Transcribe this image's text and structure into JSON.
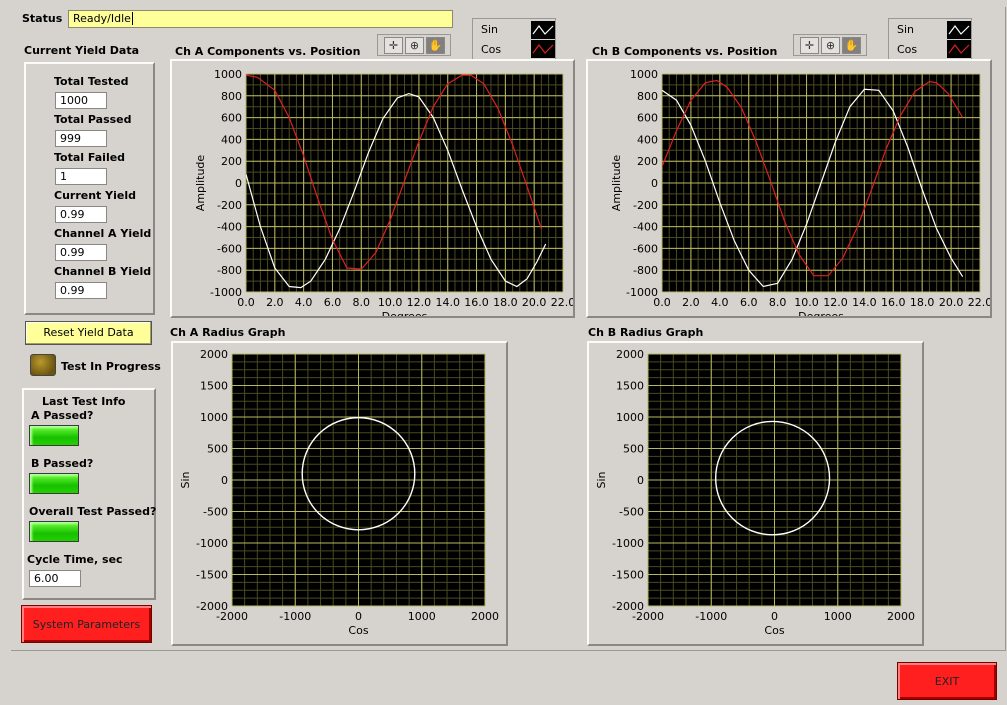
{
  "status": {
    "label": "Status",
    "value": "Ready/Idle"
  },
  "yield": {
    "title": "Current Yield Data",
    "total_tested_label": "Total Tested",
    "total_tested": "1000",
    "total_passed_label": "Total Passed",
    "total_passed": "999",
    "total_failed_label": "Total Failed",
    "total_failed": "1",
    "current_yield_label": "Current Yield",
    "current_yield": "0.99",
    "channel_a_yield_label": "Channel A Yield",
    "channel_a_yield": "0.99",
    "channel_b_yield_label": "Channel B Yield",
    "channel_b_yield": "0.99"
  },
  "reset_button": "Reset Yield Data",
  "test_in_progress_label": "Test In Progress",
  "last_test": {
    "title": "Last Test Info",
    "a_passed_label": "A Passed?",
    "b_passed_label": "B Passed?",
    "overall_label": "Overall Test Passed?",
    "cycle_time_label": "Cycle Time, sec",
    "cycle_time": "6.00"
  },
  "system_parameters_button": "System Parameters",
  "exit_button": "EXIT",
  "legend": {
    "sin": "Sin",
    "cos": "Cos"
  },
  "colors": {
    "sin": "#ffffff",
    "cos": "#e02020",
    "plot_bg": "#000000",
    "grid": "#b8b860",
    "led_green": "#22d000",
    "button_red": "#ff1f1f",
    "status_bg": "#ffff99"
  },
  "chart_data": [
    {
      "id": "chA",
      "type": "line",
      "title": "Ch A Components vs. Position",
      "xlabel": "Degrees",
      "ylabel": "Amplitude",
      "xlim": [
        0,
        22
      ],
      "ylim": [
        -1000,
        1000
      ],
      "xticks": [
        "0.0",
        "2.0",
        "4.0",
        "6.0",
        "8.0",
        "10.0",
        "12.0",
        "14.0",
        "16.0",
        "18.0",
        "20.0",
        "22.0"
      ],
      "yticks": [
        "1000",
        "800",
        "600",
        "400",
        "200",
        "0",
        "-200",
        "-400",
        "-600",
        "-800",
        "-1000"
      ],
      "series": [
        {
          "name": "Sin",
          "color": "#ffffff",
          "x": [
            0,
            1,
            2,
            3,
            3.8,
            4.5,
            5.5,
            6.5,
            7.5,
            8.5,
            9.5,
            10.5,
            11.3,
            12,
            13,
            14,
            15,
            16,
            17,
            18,
            18.8,
            19.5,
            20.2,
            20.8
          ],
          "y": [
            80,
            -400,
            -780,
            -950,
            -960,
            -900,
            -700,
            -420,
            -80,
            280,
            590,
            780,
            820,
            790,
            600,
            300,
            -60,
            -400,
            -700,
            -900,
            -950,
            -880,
            -720,
            -560
          ]
        },
        {
          "name": "Cos",
          "color": "#e02020",
          "x": [
            0,
            0.8,
            2,
            3,
            4,
            5,
            6,
            7,
            8,
            9,
            10,
            11,
            12,
            13,
            14,
            15,
            15.6,
            16.5,
            17.5,
            18.5,
            19.5,
            20.5
          ],
          "y": [
            990,
            970,
            850,
            600,
            250,
            -150,
            -520,
            -780,
            -790,
            -640,
            -340,
            20,
            380,
            700,
            910,
            990,
            990,
            910,
            680,
            350,
            -30,
            -420
          ]
        }
      ]
    },
    {
      "id": "chB",
      "type": "line",
      "title": "Ch B Components vs. Position",
      "xlabel": "Degrees",
      "ylabel": "Amplitude",
      "xlim": [
        0,
        22
      ],
      "ylim": [
        -1000,
        1000
      ],
      "xticks": [
        "0.0",
        "2.0",
        "4.0",
        "6.0",
        "8.0",
        "10.0",
        "12.0",
        "14.0",
        "16.0",
        "18.0",
        "20.0",
        "22.0"
      ],
      "yticks": [
        "1000",
        "800",
        "600",
        "400",
        "200",
        "0",
        "-200",
        "-400",
        "-600",
        "-800",
        "-1000"
      ],
      "series": [
        {
          "name": "Sin",
          "color": "#ffffff",
          "x": [
            0,
            1,
            2,
            3,
            4,
            5,
            6,
            7,
            8,
            9,
            10,
            11,
            12,
            13,
            14,
            15,
            16,
            17,
            18,
            19,
            20,
            20.8
          ],
          "y": [
            850,
            760,
            530,
            200,
            -180,
            -530,
            -800,
            -950,
            -920,
            -700,
            -380,
            0,
            380,
            700,
            860,
            850,
            660,
            330,
            -60,
            -420,
            -690,
            -860
          ]
        },
        {
          "name": "Cos",
          "color": "#e02020",
          "x": [
            0,
            1,
            2,
            3,
            3.8,
            4.5,
            5.5,
            6.5,
            7.5,
            8.5,
            9.5,
            10.5,
            11.5,
            12.5,
            13.5,
            14.5,
            15.5,
            16.5,
            17.5,
            18.5,
            19,
            19.8,
            20.8
          ],
          "y": [
            150,
            480,
            760,
            920,
            940,
            880,
            690,
            380,
            20,
            -360,
            -660,
            -850,
            -850,
            -690,
            -410,
            -60,
            310,
            620,
            840,
            930,
            920,
            820,
            600
          ]
        }
      ]
    },
    {
      "id": "radA",
      "type": "scatter",
      "title": "Ch A Radius Graph",
      "xlabel": "Cos",
      "ylabel": "Sin",
      "xlim": [
        -2000,
        2000
      ],
      "ylim": [
        -2000,
        2000
      ],
      "xticks": [
        "-2000",
        "-1000",
        "0",
        "1000",
        "2000"
      ],
      "yticks": [
        "2000",
        "1500",
        "1000",
        "500",
        "0",
        "-500",
        "-1000",
        "-1500",
        "-2000"
      ],
      "circle": {
        "cx": 0,
        "cy": 100,
        "r": 890
      }
    },
    {
      "id": "radB",
      "type": "scatter",
      "title": "Ch B Radius Graph",
      "xlabel": "Cos",
      "ylabel": "Sin",
      "xlim": [
        -2000,
        2000
      ],
      "ylim": [
        -2000,
        2000
      ],
      "xticks": [
        "-2000",
        "-1000",
        "0",
        "1000",
        "2000"
      ],
      "yticks": [
        "2000",
        "1500",
        "1000",
        "500",
        "0",
        "-500",
        "-1000",
        "-1500",
        "-2000"
      ],
      "circle": {
        "cx": -30,
        "cy": 30,
        "r": 900
      }
    }
  ]
}
